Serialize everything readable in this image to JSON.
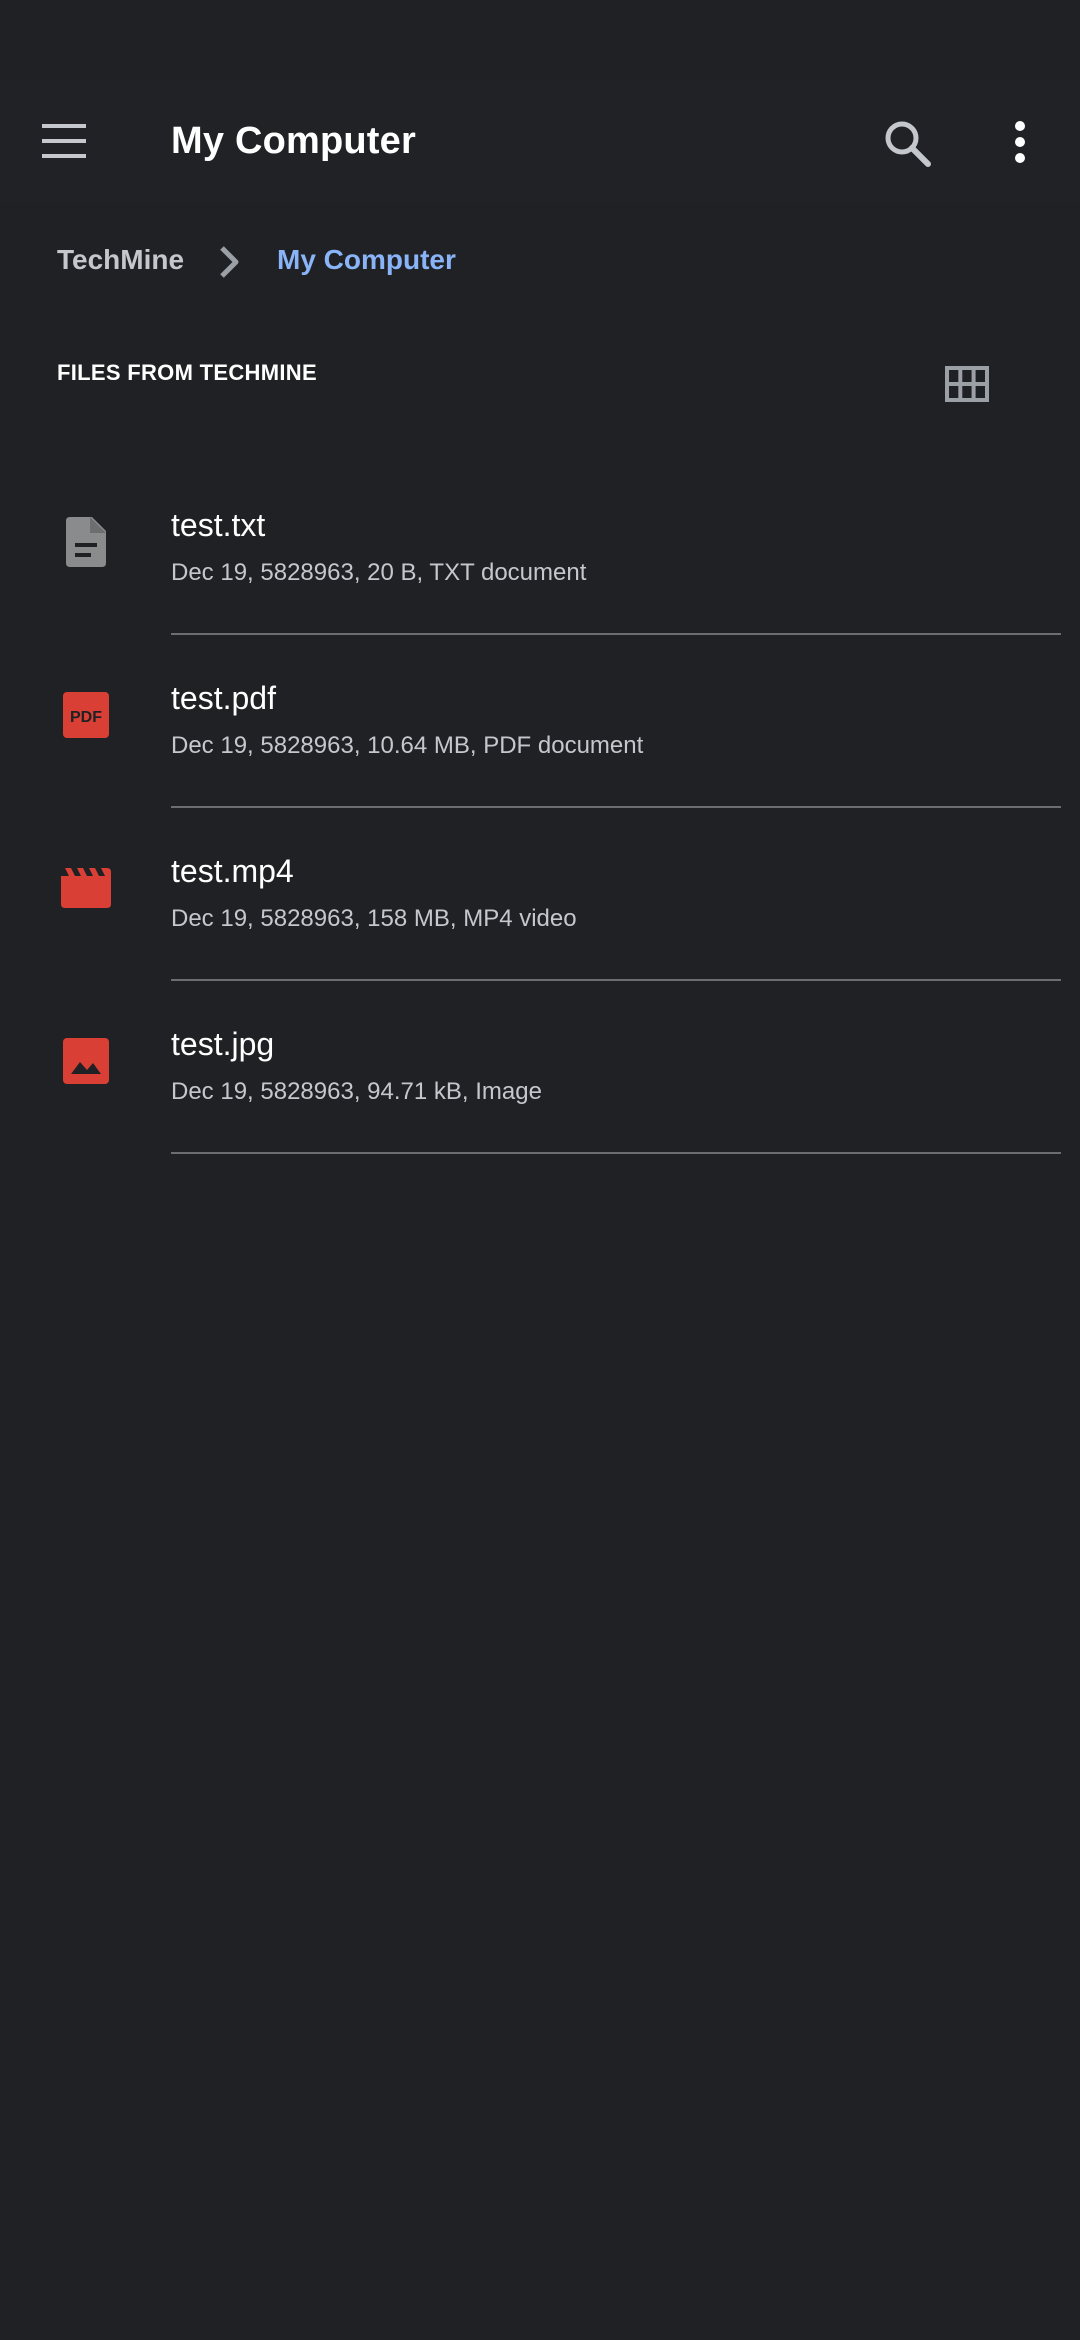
{
  "app_bar": {
    "title": "My Computer",
    "icons": {
      "menu": "menu-icon",
      "search": "search-icon",
      "more": "more-vert-icon"
    }
  },
  "breadcrumb": {
    "root": "TechMine",
    "current": "My Computer"
  },
  "section": {
    "header": "FILES FROM TECHMINE",
    "view_toggle_icon": "grid-view-icon"
  },
  "files": [
    {
      "name": "test.txt",
      "meta": "Dec 19, 5828963, 20 B, TXT document",
      "icon": "text-document-icon",
      "icon_color": "#8a8b8d"
    },
    {
      "name": "test.pdf",
      "meta": "Dec 19, 5828963, 10.64 MB, PDF document",
      "icon": "pdf-icon",
      "icon_color": "#d93f35",
      "icon_text": "PDF"
    },
    {
      "name": "test.mp4",
      "meta": "Dec 19, 5828963, 158 MB, MP4 video",
      "icon": "video-clapper-icon",
      "icon_color": "#d93f35"
    },
    {
      "name": "test.jpg",
      "meta": "Dec 19, 5828963, 94.71 kB, Image",
      "icon": "image-icon",
      "icon_color": "#d93f35"
    }
  ],
  "colors": {
    "background": "#202124",
    "accent": "#8ab4f8",
    "secondary_text": "#c4c7cc",
    "divider": "#6b6d71"
  }
}
